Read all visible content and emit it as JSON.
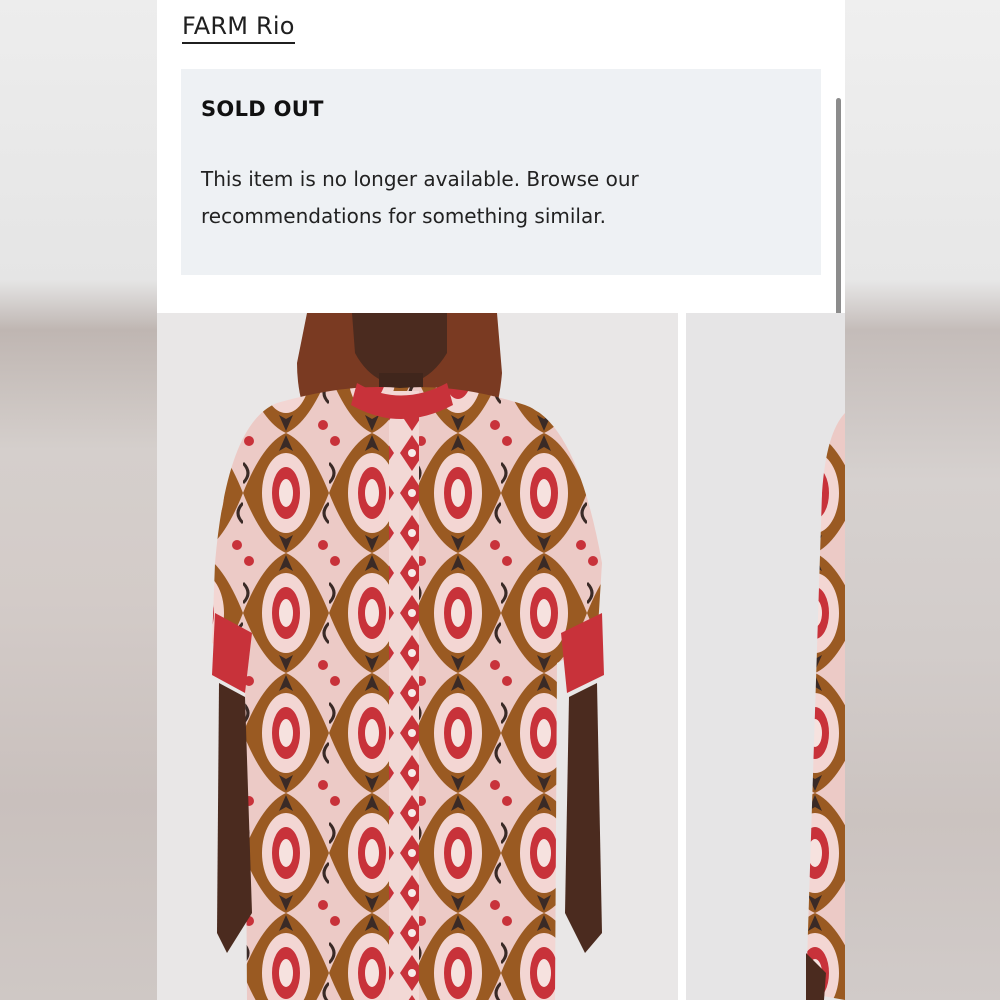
{
  "product": {
    "brand": "FARM Rio"
  },
  "notice": {
    "title": "SOLD OUT",
    "message": "This item is no longer available. Browse our recommendations for something similar."
  },
  "gallery": {
    "images": [
      {
        "alt": "Model wearing printed oversized button-up shirt"
      },
      {
        "alt": "Alternate view of printed shirt"
      }
    ]
  },
  "colors": {
    "notice_bg": "#eef1f4",
    "print_pink": "#f1c9c8",
    "print_red": "#c8323a",
    "print_brown": "#9a5a22",
    "print_dark": "#3a2a26"
  }
}
